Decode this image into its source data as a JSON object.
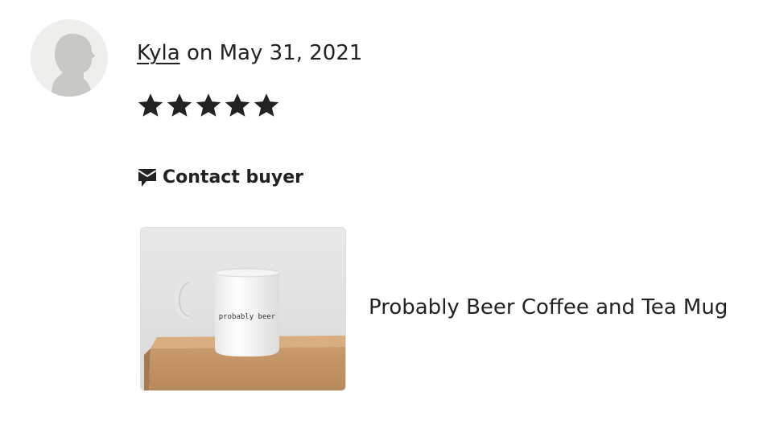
{
  "review": {
    "reviewer_name": "Kyla",
    "date_prefix": "on",
    "date": "May 31, 2021",
    "rating": 5,
    "rating_max": 5,
    "contact_label": "Contact buyer",
    "contact_icon": "message-icon"
  },
  "listing": {
    "title": "Probably Beer Coffee and Tea Mug",
    "mug_text": "probably beer"
  },
  "colors": {
    "text": "#222222",
    "avatar_bg": "#eeeeec",
    "avatar_silhouette": "#c8c8c6"
  }
}
